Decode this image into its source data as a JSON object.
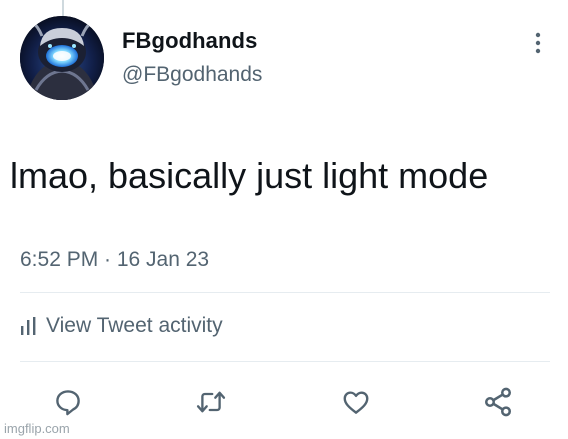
{
  "tweet": {
    "display_name": "FBgodhands",
    "handle": "@FBgodhands",
    "text": "lmao, basically just light mode",
    "timestamp": "6:52 PM · 16 Jan 23",
    "activity_label": "View Tweet activity"
  },
  "icons": {
    "more": "more-vertical-icon",
    "activity": "bar-chart-icon",
    "reply": "reply-icon",
    "retweet": "retweet-icon",
    "like": "heart-icon",
    "share": "share-icon"
  },
  "colors": {
    "text_primary": "#0f1419",
    "text_secondary": "#536471",
    "divider": "#e6ecf0",
    "icon": "#536471"
  },
  "watermark": "imgflip.com"
}
